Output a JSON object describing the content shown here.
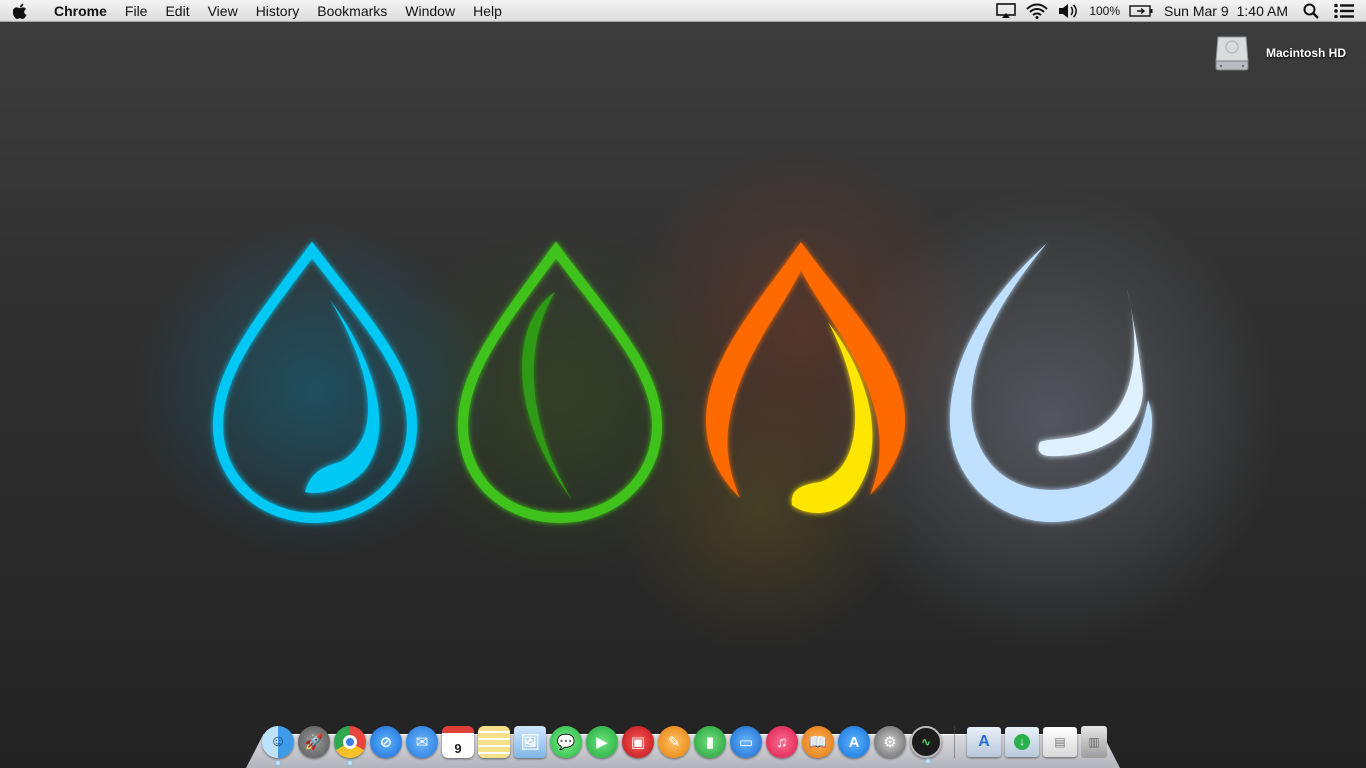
{
  "menubar": {
    "app_name": "Chrome",
    "menus": [
      "File",
      "Edit",
      "View",
      "History",
      "Bookmarks",
      "Window",
      "Help"
    ],
    "battery": "100%",
    "date": "Sun Mar 9",
    "time": "1:40 AM",
    "status_icons": [
      "airplay-icon",
      "wifi-icon",
      "volume-icon",
      "battery-icon",
      "spotlight-search-icon",
      "notification-center-icon"
    ]
  },
  "desktop": {
    "drive_label": "Macintosh HD"
  },
  "dock": {
    "apps": [
      {
        "name": "Finder",
        "color": "#5fb0ee"
      },
      {
        "name": "Launchpad",
        "color": "#7a7a7a"
      },
      {
        "name": "Google Chrome",
        "color": "#e8453c"
      },
      {
        "name": "Safari",
        "color": "#2a8cf0"
      },
      {
        "name": "Mail",
        "color": "#3c8fe8"
      },
      {
        "name": "Calendar",
        "color": "#f3f3f3",
        "day": "9"
      },
      {
        "name": "Notes",
        "color": "#f6d24b"
      },
      {
        "name": "Preview",
        "color": "#7fb6e6"
      },
      {
        "name": "Messages",
        "color": "#3fd25c"
      },
      {
        "name": "FaceTime",
        "color": "#2ec24a"
      },
      {
        "name": "Photo Booth",
        "color": "#d8262b"
      },
      {
        "name": "Pages",
        "color": "#f39a1b"
      },
      {
        "name": "Numbers",
        "color": "#32b54a"
      },
      {
        "name": "Keynote",
        "color": "#1e7ee0"
      },
      {
        "name": "iTunes",
        "color": "#f23a66"
      },
      {
        "name": "iBooks",
        "color": "#f08a1d"
      },
      {
        "name": "App Store",
        "color": "#1d8ef2"
      },
      {
        "name": "System Preferences",
        "color": "#8c8c8c"
      },
      {
        "name": "Activity Monitor",
        "color": "#222222"
      }
    ],
    "stacks": [
      "Applications",
      "Downloads",
      "Documents"
    ]
  },
  "colors": {
    "water": "#00c8f5",
    "earth": "#3fc21a",
    "fire": "#ff6a00",
    "fire_inner": "#ffe600",
    "air": "#bfe0ff"
  }
}
